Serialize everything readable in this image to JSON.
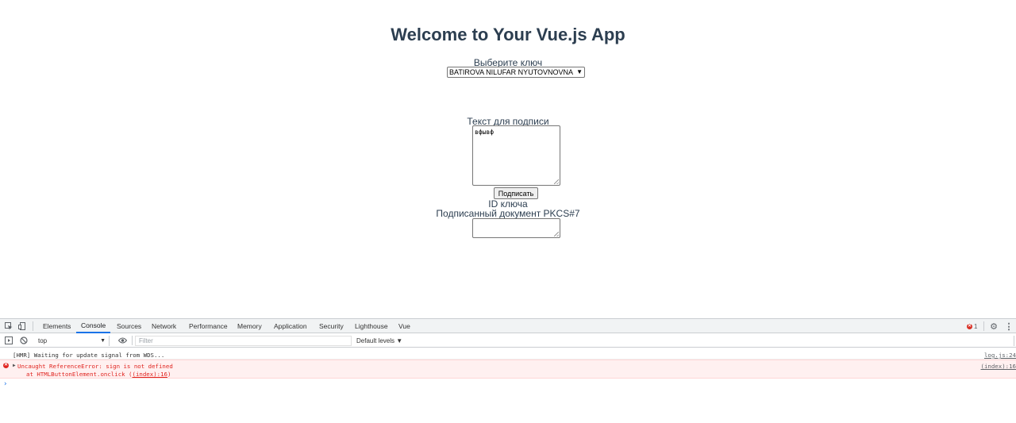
{
  "app": {
    "title": "Welcome to Your Vue.js App",
    "key_label": "Выберите ключ",
    "key_select_value": "BATIROVA NILUFAR NYUTOVNOVNA",
    "text_label": "Текст для подписи",
    "text_value": "вфывф",
    "sign_button": "Подписать",
    "key_id_label": "ID ключа",
    "signed_doc_label": "Подписанный документ PKCS#7"
  },
  "devtools": {
    "tabs": [
      "Elements",
      "Console",
      "Sources",
      "Network",
      "Performance",
      "Memory",
      "Application",
      "Security",
      "Lighthouse",
      "Vue"
    ],
    "active_tab": "Console",
    "error_count": "1",
    "context": "top",
    "filter_placeholder": "Filter",
    "levels": "Default levels ▼",
    "console": {
      "info_message": "[HMR] Waiting for update signal from WDS...",
      "info_source": "log.js:24",
      "error_message": "Uncaught ReferenceError: sign is not defined",
      "error_stack_prefix": "at HTMLButtonElement.onclick (",
      "error_stack_link": "(index):16",
      "error_stack_suffix": ")",
      "error_source": "(index):16"
    }
  },
  "colors": {
    "title": "#2c3e50",
    "accent": "#1a73e8",
    "error": "#e0241f",
    "error_bg": "#fff0f0"
  }
}
